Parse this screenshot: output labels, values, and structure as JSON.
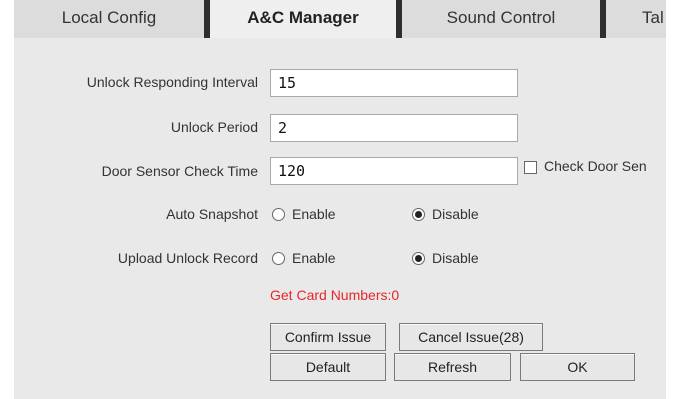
{
  "tabs": [
    {
      "label": "Local Config",
      "active": false
    },
    {
      "label": "A&C Manager",
      "active": true
    },
    {
      "label": "Sound Control",
      "active": false
    },
    {
      "label": "Tal",
      "active": false
    }
  ],
  "form": {
    "unlock_interval": {
      "label": "Unlock Responding Interval",
      "value": "15"
    },
    "unlock_period": {
      "label": "Unlock Period",
      "value": "2"
    },
    "door_sensor": {
      "label": "Door Sensor Check Time",
      "value": "120",
      "checkbox_label": "Check Door Sen",
      "checked": false
    },
    "auto_snapshot": {
      "label": "Auto Snapshot",
      "options": [
        "Enable",
        "Disable"
      ],
      "selected": "Disable"
    },
    "upload_unlock_record": {
      "label": "Upload Unlock Record",
      "options": [
        "Enable",
        "Disable"
      ],
      "selected": "Disable"
    }
  },
  "card_numbers": "Get Card Numbers:0",
  "buttons": {
    "confirm_issue": "Confirm Issue",
    "cancel_issue": "Cancel Issue(28)",
    "default": "Default",
    "refresh": "Refresh",
    "ok": "OK"
  },
  "colors": {
    "panel_bg": "#e9e9e9",
    "tab_bg": "#dcdcdc",
    "tab_separator": "#2e2e2e",
    "card_numbers_text": "#e8262a"
  }
}
